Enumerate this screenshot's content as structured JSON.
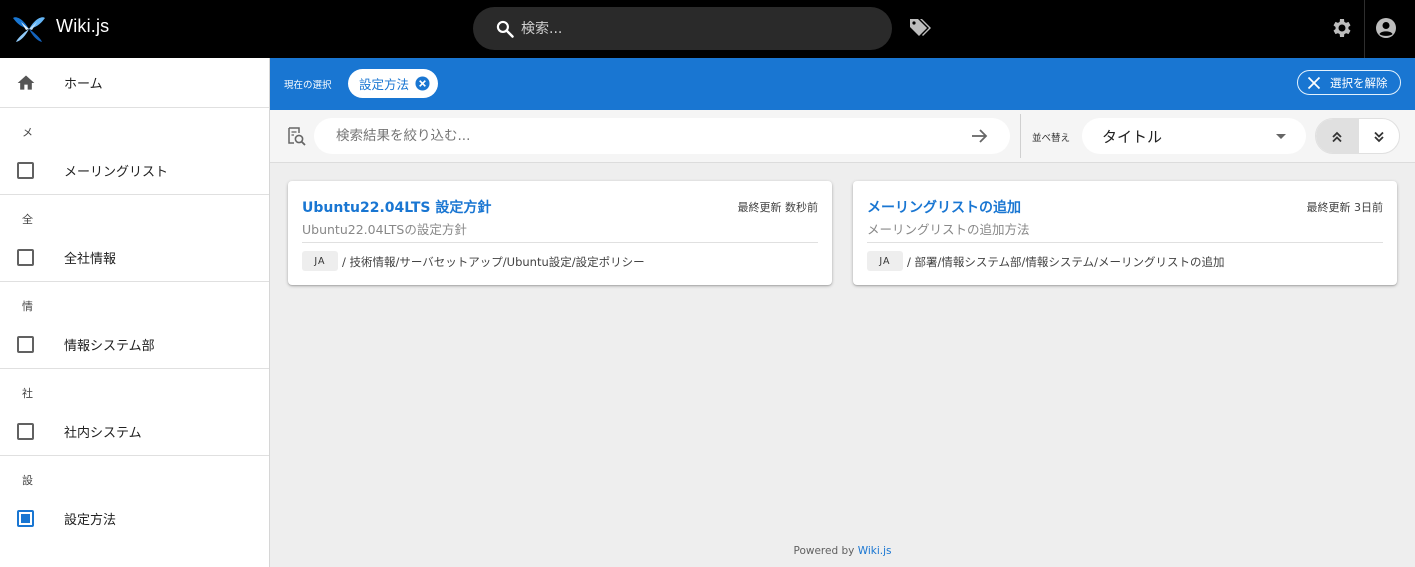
{
  "app": {
    "title": "Wiki.js"
  },
  "header": {
    "search_placeholder": "検索..."
  },
  "sidebar": {
    "home_label": "ホーム",
    "groups": [
      {
        "head": "メ",
        "label": "メーリングリスト",
        "checked": false
      },
      {
        "head": "全",
        "label": "全社情報",
        "checked": false
      },
      {
        "head": "情",
        "label": "情報システム部",
        "checked": false
      },
      {
        "head": "社",
        "label": "社内システム",
        "checked": false
      },
      {
        "head": "設",
        "label": "設定方法",
        "checked": true
      }
    ]
  },
  "selection": {
    "current_label": "現在の選択",
    "chip_label": "設定方法",
    "clear_label": "選択を解除"
  },
  "filter": {
    "placeholder": "検索結果を絞り込む...",
    "sort_label": "並べ替え",
    "sort_value": "タイトル"
  },
  "results": [
    {
      "title": "Ubuntu22.04LTS 設定方針",
      "description": "Ubuntu22.04LTSの設定方針",
      "updated": "最終更新 数秒前",
      "locale": "JA",
      "path": "/ 技術情報/サーバセットアップ/Ubuntu設定/設定ポリシー"
    },
    {
      "title": "メーリングリストの追加",
      "description": "メーリングリストの追加方法",
      "updated": "最終更新 3日前",
      "locale": "JA",
      "path": "/ 部署/情報システム部/情報システム/メーリングリストの追加"
    }
  ],
  "footer": {
    "prefix": "Powered by",
    "brand": "Wiki.js"
  },
  "colors": {
    "accent": "#1976d2",
    "topbar": "#000000",
    "background": "#eeeeee"
  }
}
